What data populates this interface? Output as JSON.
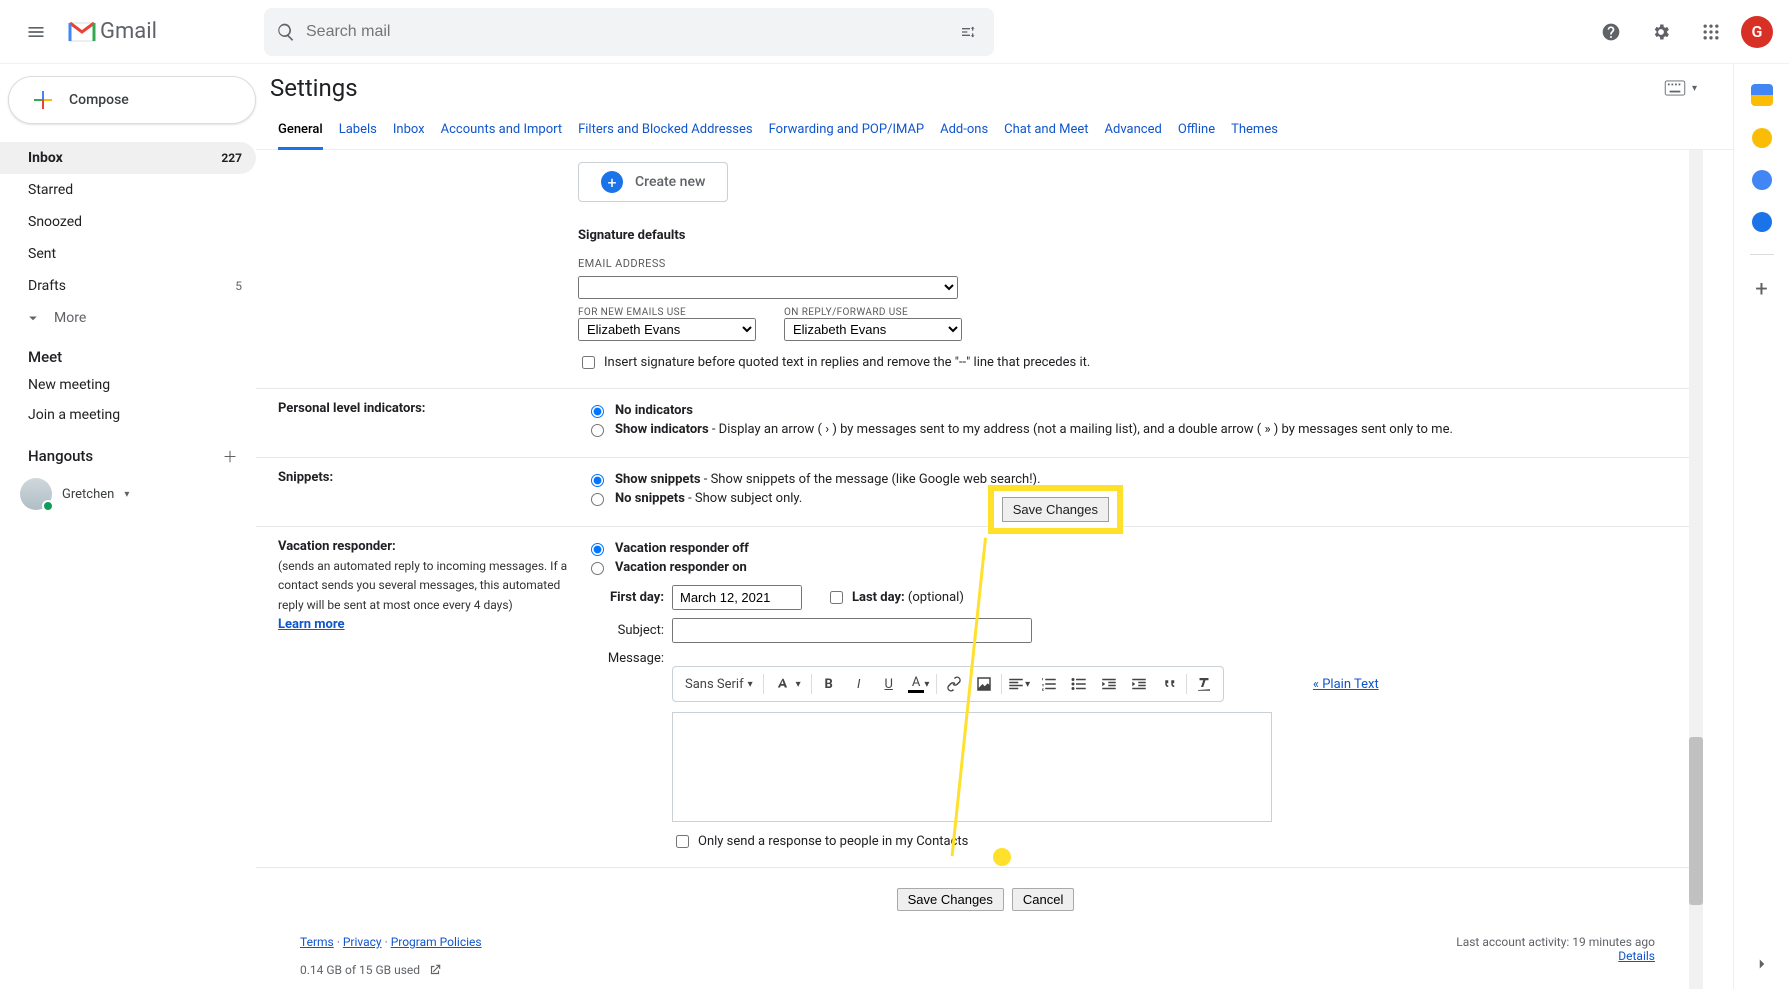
{
  "header": {
    "search_placeholder": "Search mail",
    "avatar_initial": "G"
  },
  "sidebar": {
    "compose": "Compose",
    "items": [
      {
        "label": "Inbox",
        "count": "227",
        "active": true
      },
      {
        "label": "Starred"
      },
      {
        "label": "Snoozed"
      },
      {
        "label": "Sent"
      },
      {
        "label": "Drafts",
        "count": "5"
      }
    ],
    "more": "More",
    "meet_section": "Meet",
    "meet_items": [
      {
        "label": "New meeting"
      },
      {
        "label": "Join a meeting"
      }
    ],
    "hangouts_section": "Hangouts",
    "hangouts_user": "Gretchen"
  },
  "page": {
    "title": "Settings",
    "tabs": [
      {
        "label": "General",
        "active": true
      },
      {
        "label": "Labels"
      },
      {
        "label": "Inbox"
      },
      {
        "label": "Accounts and Import"
      },
      {
        "label": "Filters and Blocked Addresses"
      },
      {
        "label": "Forwarding and POP/IMAP"
      },
      {
        "label": "Add-ons"
      },
      {
        "label": "Chat and Meet"
      },
      {
        "label": "Advanced"
      },
      {
        "label": "Offline"
      },
      {
        "label": "Themes"
      }
    ]
  },
  "signature": {
    "create_new": "Create new",
    "defaults_title": "Signature defaults",
    "email_address_label": "EMAIL ADDRESS",
    "for_new_label": "FOR NEW EMAILS USE",
    "on_reply_label": "ON REPLY/FORWARD USE",
    "select_value": "Elizabeth Evans",
    "insert_sig_text": "Insert signature before quoted text in replies and remove the \"--\" line that precedes it."
  },
  "indicators": {
    "section_label": "Personal level indicators:",
    "no_ind": "No indicators",
    "show_ind_pre": "Show indicators",
    "show_ind_post": " - Display an arrow ( › ) by messages sent to my address (not a mailing list), and a double arrow ( » ) by messages sent only to me."
  },
  "snippets": {
    "section_label": "Snippets:",
    "show_pre": "Show snippets",
    "show_post": " - Show snippets of the message (like Google web search!).",
    "no_pre": "No snippets",
    "no_post": " - Show subject only."
  },
  "vacation": {
    "section_label": "Vacation responder:",
    "description": "(sends an automated reply to incoming messages. If a contact sends you several messages, this automated reply will be sent at most once every 4 days)",
    "learn_more": "Learn more",
    "off_label": "Vacation responder off",
    "on_label": "Vacation responder on",
    "first_day_label": "First day:",
    "first_day_value": "March 12, 2021",
    "last_day_label": "Last day:",
    "last_day_suffix": " (optional)",
    "subject_label": "Subject:",
    "subject_value": "",
    "message_label": "Message:",
    "font_name": "Sans Serif",
    "plain_text": "« Plain Text",
    "only_contacts": "Only send a response to people in my Contacts"
  },
  "callout": {
    "text": "Save Changes"
  },
  "buttons": {
    "save": "Save Changes",
    "cancel": "Cancel"
  },
  "footer": {
    "left_links": [
      "Terms",
      "Privacy",
      "Program Policies"
    ],
    "storage": "0.14 GB of 15 GB used",
    "right1": "Last account activity: 19 minutes ago",
    "right2": "Details"
  }
}
